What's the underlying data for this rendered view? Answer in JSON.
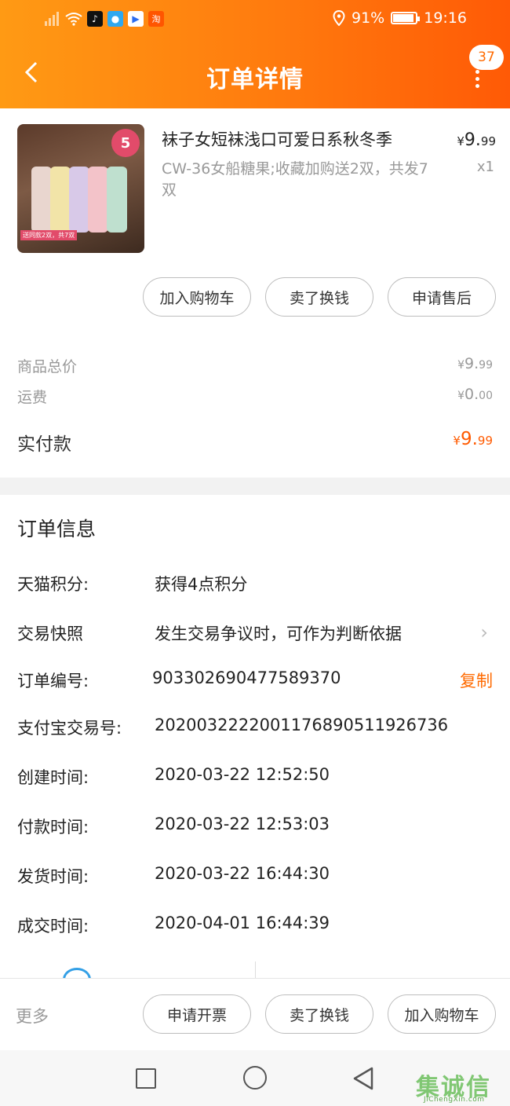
{
  "status_bar": {
    "battery_text": "91%",
    "battery_level": 0.91,
    "time": "19:16",
    "app_icons": [
      "tiktok-icon",
      "lightbulb-icon",
      "youku-icon",
      "taobao-icon"
    ]
  },
  "header": {
    "title": "订单详情",
    "back_icon": "chevron-left-icon",
    "message_count": "37",
    "gradient_colors": [
      "#ff9a14",
      "#ff5a06"
    ]
  },
  "product": {
    "title": "袜子女短袜浅口可爱日系秋冬季",
    "sku": "CW-36女船糖果;收藏加购送2双，共发7双",
    "price_currency": "¥",
    "price_int": "9.",
    "price_dec": "99",
    "quantity": "x1",
    "image_badge": "5",
    "image_caption": "送同款2双，共7双",
    "actions": [
      "加入购物车",
      "卖了换钱",
      "申请售后"
    ]
  },
  "summary": {
    "goods_total_label": "商品总价",
    "goods_total_cur": "¥",
    "goods_total_int": "9.",
    "goods_total_dec": "99",
    "shipping_label": "运费",
    "shipping_cur": "¥",
    "shipping_int": "0.",
    "shipping_dec": "00",
    "paid_label": "实付款",
    "paid_cur": "¥",
    "paid_int": "9.",
    "paid_dec": "99",
    "accent_color": "#ff5a00"
  },
  "order_info": {
    "title": "订单信息",
    "rows": [
      {
        "key": "天猫积分:",
        "value": "获得4点积分"
      },
      {
        "key": "交易快照",
        "value": "发生交易争议时，可作为判断依据"
      },
      {
        "key": "订单编号:",
        "value": "903302690477589370",
        "action": "复制"
      },
      {
        "key": "支付宝交易号:",
        "value": "2020032222001176890511926736"
      },
      {
        "key": "创建时间:",
        "value": "2020-03-22 12:52:50"
      },
      {
        "key": "付款时间:",
        "value": "2020-03-22 12:53:03"
      },
      {
        "key": "发货时间:",
        "value": "2020-03-22 16:44:30"
      },
      {
        "key": "成交时间:",
        "value": "2020-04-01 16:44:39"
      }
    ]
  },
  "bottom_bar": {
    "more": "更多",
    "actions": [
      "申请开票",
      "卖了换钱",
      "加入购物车"
    ]
  },
  "watermark": {
    "main": "集诚信",
    "sub": "JiChengXin.com"
  }
}
